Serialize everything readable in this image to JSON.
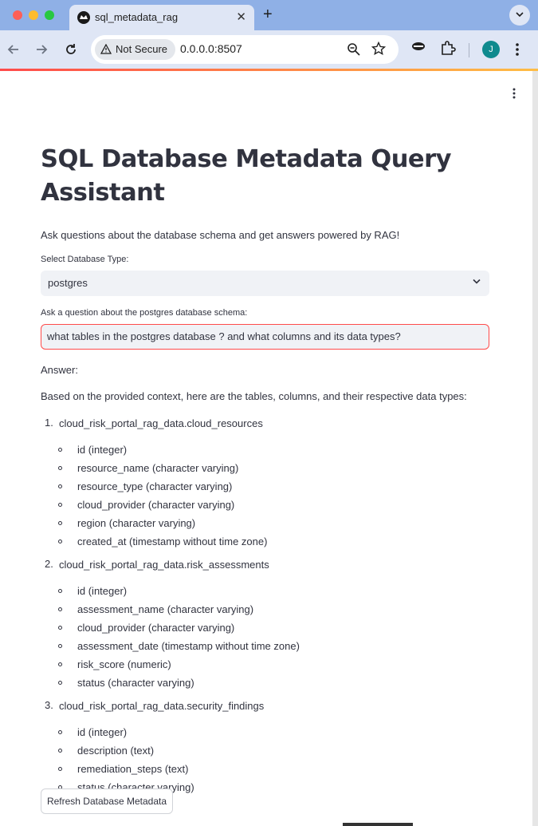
{
  "browser": {
    "tab_title": "sql_metadata_rag",
    "security_label": "Not Secure",
    "url": "0.0.0.0:8507",
    "profile_initial": "J"
  },
  "page": {
    "title": "SQL Database Metadata Query Assistant",
    "subtitle": "Ask questions about the database schema and get answers powered by RAG!",
    "db_select_label": "Select Database Type:",
    "db_select_value": "postgres",
    "question_label": "Ask a question about the postgres database schema:",
    "question_value": "what tables in the postgres database ? and what columns and its data types?",
    "answer_label": "Answer:",
    "answer_intro": "Based on the provided context, here are the tables, columns, and their respective data types:",
    "tables": [
      {
        "num": "1.",
        "name": "cloud_risk_portal_rag_data.cloud_resources",
        "columns": [
          "id (integer)",
          "resource_name (character varying)",
          "resource_type (character varying)",
          "cloud_provider (character varying)",
          "region (character varying)",
          "created_at (timestamp without time zone)"
        ]
      },
      {
        "num": "2.",
        "name": "cloud_risk_portal_rag_data.risk_assessments",
        "columns": [
          "id (integer)",
          "assessment_name (character varying)",
          "cloud_provider (character varying)",
          "assessment_date (timestamp without time zone)",
          "risk_score (numeric)",
          "status (character varying)"
        ]
      },
      {
        "num": "3.",
        "name": "cloud_risk_portal_rag_data.security_findings",
        "columns": [
          "id (integer)",
          "description (text)",
          "remediation_steps (text)",
          "status (character varying)"
        ]
      }
    ],
    "refresh_button": "Refresh Database Metadata"
  }
}
